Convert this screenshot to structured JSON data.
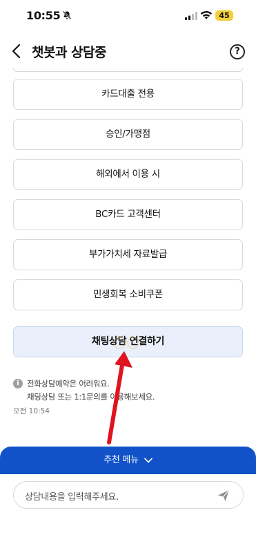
{
  "status_bar": {
    "time": "10:55",
    "battery": "45"
  },
  "header": {
    "title": "챗봇과 상담중",
    "help_glyph": "?"
  },
  "menu_buttons": [
    {
      "label": "카드대출 전용"
    },
    {
      "label": "승인/가맹점"
    },
    {
      "label": "해외에서 이용 시"
    },
    {
      "label": "BC카드 고객센터"
    },
    {
      "label": "부가가치세 자료발급"
    },
    {
      "label": "민생회복 소비쿠폰"
    }
  ],
  "connect_button": {
    "label": "채팅상담 연결하기"
  },
  "notice": {
    "icon_glyph": "i",
    "line1": "전화상담예약은 어려워요.",
    "line2": "채팅상담 또는 1:1문의를 이용해보세요.",
    "time": "오전 10:54"
  },
  "bottom": {
    "recommend_label": "추천 메뉴",
    "input_placeholder": "상담내용을 입력해주세요."
  },
  "colors": {
    "accent": "#1152c9",
    "connect_bg": "#e9f0fb",
    "arrow": "#e0131f"
  }
}
